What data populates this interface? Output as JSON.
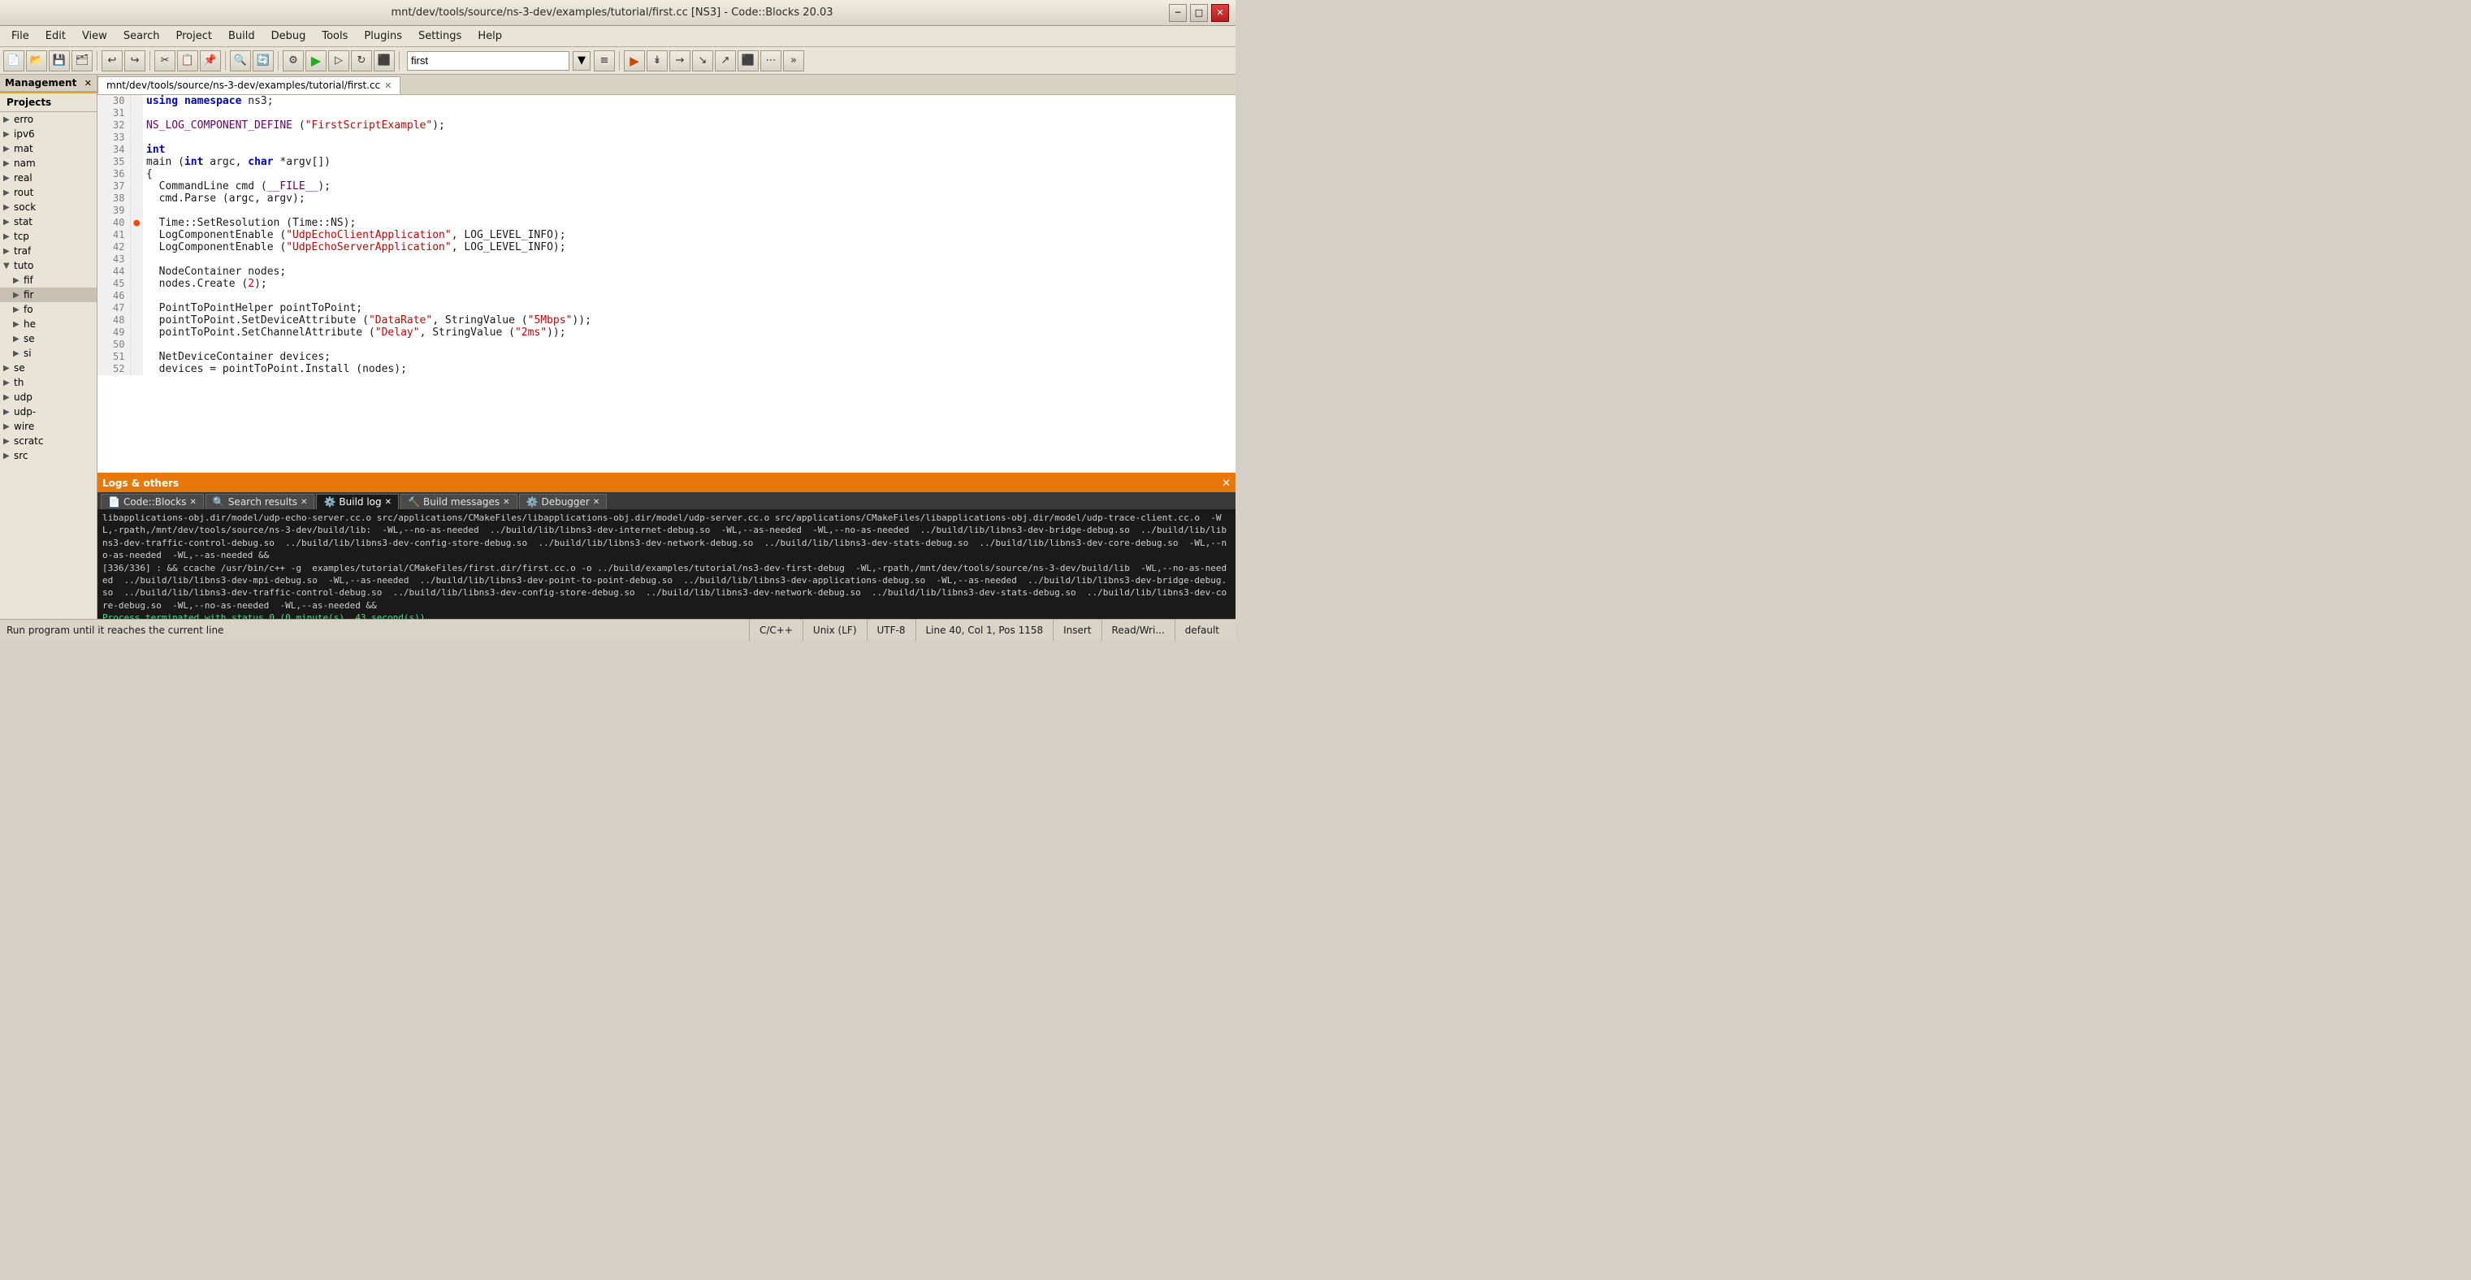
{
  "window": {
    "title": "mnt/dev/tools/source/ns-3-dev/examples/tutorial/first.cc [NS3] - Code::Blocks 20.03"
  },
  "menu": {
    "items": [
      "File",
      "Edit",
      "View",
      "Search",
      "Project",
      "Build",
      "Debug",
      "Tools",
      "Plugins",
      "Settings",
      "Help"
    ]
  },
  "toolbar": {
    "target": "first"
  },
  "sidebar": {
    "header": "Management",
    "tab": "Projects",
    "tree": [
      {
        "label": "erro",
        "indent": 0,
        "expanded": false
      },
      {
        "label": "ipv6",
        "indent": 0,
        "expanded": false
      },
      {
        "label": "mat",
        "indent": 0,
        "expanded": false
      },
      {
        "label": "nam",
        "indent": 0,
        "expanded": false
      },
      {
        "label": "real",
        "indent": 0,
        "expanded": false
      },
      {
        "label": "rout",
        "indent": 0,
        "expanded": false
      },
      {
        "label": "sock",
        "indent": 0,
        "expanded": false
      },
      {
        "label": "stat",
        "indent": 0,
        "expanded": false
      },
      {
        "label": "tcp",
        "indent": 0,
        "expanded": false
      },
      {
        "label": "traf",
        "indent": 0,
        "expanded": false
      },
      {
        "label": "tuto",
        "indent": 0,
        "expanded": true
      },
      {
        "label": "fif",
        "indent": 1,
        "expanded": false
      },
      {
        "label": "fir",
        "indent": 1,
        "expanded": false,
        "selected": true
      },
      {
        "label": "fo",
        "indent": 1,
        "expanded": false
      },
      {
        "label": "he",
        "indent": 1,
        "expanded": false
      },
      {
        "label": "se",
        "indent": 1,
        "expanded": false
      },
      {
        "label": "si",
        "indent": 1,
        "expanded": false
      },
      {
        "label": "se",
        "indent": 0,
        "expanded": false
      },
      {
        "label": "th",
        "indent": 0,
        "expanded": false
      },
      {
        "label": "udp",
        "indent": 0,
        "expanded": false
      },
      {
        "label": "udp-",
        "indent": 0,
        "expanded": false
      },
      {
        "label": "wire",
        "indent": 0,
        "expanded": false
      },
      {
        "label": "scratc",
        "indent": 0,
        "expanded": false
      },
      {
        "label": "src",
        "indent": 0,
        "expanded": false
      }
    ]
  },
  "editor": {
    "tab_file": "mnt/dev/tools/source/ns-3-dev/examples/tutorial/first.cc",
    "lines": [
      {
        "num": 30,
        "marker": "",
        "code": "using namespace ns3;",
        "tokens": [
          {
            "t": "kw",
            "v": "using"
          },
          {
            "t": "",
            "v": " "
          },
          {
            "t": "kw",
            "v": "namespace"
          },
          {
            "t": "",
            "v": " ns3;"
          }
        ]
      },
      {
        "num": 31,
        "marker": "",
        "code": ""
      },
      {
        "num": 32,
        "marker": "",
        "code": "NS_LOG_COMPONENT_DEFINE (\"FirstScriptExample\");",
        "tokens": [
          {
            "t": "macro",
            "v": "NS_LOG_COMPONENT_DEFINE"
          },
          {
            "t": "",
            "v": " ("
          },
          {
            "t": "str",
            "v": "\"FirstScriptExample\""
          },
          {
            "t": "",
            "v": "};"
          }
        ]
      },
      {
        "num": 33,
        "marker": "",
        "code": ""
      },
      {
        "num": 34,
        "marker": "",
        "code": "int",
        "tokens": [
          {
            "t": "kw",
            "v": "int"
          }
        ]
      },
      {
        "num": 35,
        "marker": "",
        "code": "main (int argc, char *argv[])",
        "tokens": [
          {
            "t": "",
            "v": "main ("
          },
          {
            "t": "kw",
            "v": "int"
          },
          {
            "t": "",
            "v": " argc, "
          },
          {
            "t": "kw",
            "v": "char"
          },
          {
            "t": "",
            "v": " *argv[])"
          }
        ]
      },
      {
        "num": 36,
        "marker": "",
        "code": "{"
      },
      {
        "num": 37,
        "marker": "",
        "code": "  CommandLine cmd (__FILE__);",
        "tokens": [
          {
            "t": "",
            "v": "  CommandLine cmd ("
          },
          {
            "t": "macro",
            "v": "__FILE__"
          },
          {
            "t": "",
            "v": "};"
          }
        ]
      },
      {
        "num": 38,
        "marker": "",
        "code": "  cmd.Parse (argc, argv);"
      },
      {
        "num": 39,
        "marker": "",
        "code": ""
      },
      {
        "num": 40,
        "marker": "bp",
        "code": "  Time::SetResolution (Time::NS);",
        "tokens": [
          {
            "t": "",
            "v": "  Time::SetResolution (Time::NS);"
          }
        ]
      },
      {
        "num": 41,
        "marker": "",
        "code": "  LogComponentEnable (\"UdpEchoClientApplication\", LOG_LEVEL_INFO);",
        "tokens": [
          {
            "t": "",
            "v": "  LogComponentEnable ("
          },
          {
            "t": "str",
            "v": "\"UdpEchoClientApplication\""
          },
          {
            "t": "",
            "v": ", LOG_LEVEL_INFO);"
          }
        ]
      },
      {
        "num": 42,
        "marker": "",
        "code": "  LogComponentEnable (\"UdpEchoServerApplication\", LOG_LEVEL_INFO);",
        "tokens": [
          {
            "t": "",
            "v": "  LogComponentEnable ("
          },
          {
            "t": "str",
            "v": "\"UdpEchoServerApplication\""
          },
          {
            "t": "",
            "v": ", LOG_LEVEL_INFO);"
          }
        ]
      },
      {
        "num": 43,
        "marker": "",
        "code": ""
      },
      {
        "num": 44,
        "marker": "",
        "code": "  NodeContainer nodes;"
      },
      {
        "num": 45,
        "marker": "",
        "code": "  nodes.Create (2);",
        "tokens": [
          {
            "t": "",
            "v": "  nodes.Create ("
          },
          {
            "t": "num",
            "v": "2"
          },
          {
            "t": "",
            "v": "};"
          }
        ]
      },
      {
        "num": 46,
        "marker": "",
        "code": ""
      },
      {
        "num": 47,
        "marker": "",
        "code": "  PointToPointHelper pointToPoint;"
      },
      {
        "num": 48,
        "marker": "",
        "code": "  pointToPoint.SetDeviceAttribute (\"DataRate\", StringValue (\"5Mbps\"));",
        "tokens": [
          {
            "t": "",
            "v": "  pointToPoint.SetDeviceAttribute ("
          },
          {
            "t": "str",
            "v": "\"DataRate\""
          },
          {
            "t": "",
            "v": ", StringValue ("
          },
          {
            "t": "str",
            "v": "\"5Mbps\""
          },
          {
            "t": "",
            "v": "});"
          }
        ]
      },
      {
        "num": 49,
        "marker": "",
        "code": "  pointToPoint.SetChannelAttribute (\"Delay\", StringValue (\"2ms\"));",
        "tokens": [
          {
            "t": "",
            "v": "  pointToPoint.SetChannelAttribute ("
          },
          {
            "t": "str",
            "v": "\"Delay\""
          },
          {
            "t": "",
            "v": ", StringValue ("
          },
          {
            "t": "str",
            "v": "\"2ms\""
          },
          {
            "t": "",
            "v": "});"
          }
        ]
      },
      {
        "num": 50,
        "marker": "",
        "code": ""
      },
      {
        "num": 51,
        "marker": "",
        "code": "  NetDeviceContainer devices;"
      },
      {
        "num": 52,
        "marker": "",
        "code": "  devices = pointToPoint.Install (nodes);"
      }
    ]
  },
  "bottom_panel": {
    "title": "Logs & others",
    "tabs": [
      {
        "label": "Code::Blocks",
        "icon": "📄"
      },
      {
        "label": "Search results",
        "icon": "🔍"
      },
      {
        "label": "Build log",
        "icon": "⚙️",
        "active": true
      },
      {
        "label": "Build messages",
        "icon": "🔨"
      },
      {
        "label": "Debugger",
        "icon": "⚙️"
      }
    ],
    "log_lines": [
      {
        "text": "libapplications-obj.dir/model/udp-echo-server.cc.o src/applications/CMakeFiles/libapplications-obj.dir/model/udp-server.cc.o src/applications/CMakeFiles/libapplications-obj.dir/model/udp-trace-client.cc.o -WL,-rpath,/mnt/dev/tools/source/ns-3-dev/build/lib  -WL,--no-as-needed  ../build/lib/libns3-dev-internet-debug.so  -WL,--as-needed  -WL,--no-as-needed  ../build/lib/libns3-dev-bridge-debug.so  ../build/lib/libns3-dev-traffic-control-debug.so  ../build/lib/libns3-dev-config-store-debug.so  ../build/lib/libns3-dev-network-debug.so  ../build/lib/libns3-dev-stats-debug.so  ../build/lib/libns3-ev-core-debug.so  -WL,--no-as-needed  -WL,--as-needed &&",
        "class": ""
      },
      {
        "text": "[336/336] : && ccache /usr/bin/c++ -g  examples/tutorial/CMakeFiles/first.dir/first.cc.o -o ../build/examples/tutorial/ns3-dev-first-debug  -WL,-rpath,/mnt/dev/tools/source/ns-3-dev/build/lib  -WL,--no-as-needed  ../build/lib/libns3-dev-mpi-debug.so  -WL,--as-needed  ../build/lib/libns3-dev-point-to-point-debug.so  ../build/lib/libns3-dev-applications-debug.so  -WL,--as-needed  ../build/lib/libns3-dev-bridge-debug.so  ../build/lib/libns3-dev-traffic-control-debug.so  ../build/lib/libns3-dev-config-store-debug.so  ../build/lib/libns3-dev-network-debug.so  ../build/lib/libns3-dev-stats-debug.so  ../build/lib/libns3-dev-core-debug.so  -WL,--no-as-needed  -WL,--as-needed &&",
        "class": ""
      },
      {
        "text": "Process terminated with status 0 (0 minute(s), 43 second(s))",
        "class": "success"
      }
    ]
  },
  "status_bar": {
    "message": "Run program until it reaches the current line",
    "language": "C/C++",
    "line_ending": "Unix (LF)",
    "encoding": "UTF-8",
    "position": "Line 40, Col 1, Pos 1158",
    "insert_mode": "Insert",
    "file_status": "Read/Wri...",
    "default": "default"
  }
}
